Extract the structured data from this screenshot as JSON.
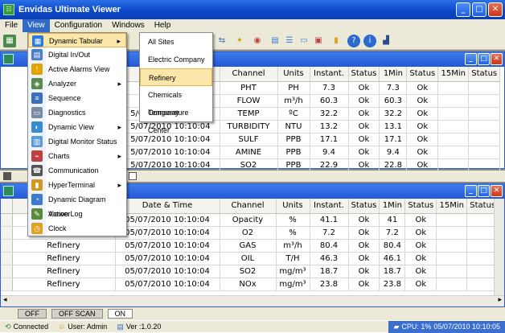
{
  "window": {
    "title": "Envidas Ultimate Viewer"
  },
  "menubar": [
    "File",
    "View",
    "Configuration",
    "Windows",
    "Help"
  ],
  "view_menu": {
    "items": [
      {
        "label": "Dynamic Tabular",
        "icon": "table-icon",
        "color": "#2d7bd6",
        "submenu": true
      },
      {
        "label": "Digital In/Out",
        "icon": "digital-io-icon",
        "color": "#4a7ec8",
        "submenu": false
      },
      {
        "label": "Active Alarms View",
        "icon": "alarm-icon",
        "color": "#e0a400",
        "submenu": false
      },
      {
        "label": "Analyzer",
        "icon": "analyzer-icon",
        "color": "#5a8b4a",
        "submenu": true
      },
      {
        "label": "Sequence",
        "icon": "sequence-icon",
        "color": "#3a6fc0",
        "submenu": false
      },
      {
        "label": "Diagnostics",
        "icon": "diagnostics-icon",
        "color": "#7a8aa0",
        "submenu": false
      },
      {
        "label": "Dynamic View",
        "icon": "dynamic-view-icon",
        "color": "#3a8ad0",
        "submenu": true
      },
      {
        "label": "Digital Monitor Status",
        "icon": "monitor-icon",
        "color": "#5a9ad6",
        "submenu": false
      },
      {
        "label": "Charts",
        "icon": "chart-icon",
        "color": "#c04040",
        "submenu": true
      },
      {
        "label": "Communication",
        "icon": "communication-icon",
        "color": "#555555",
        "submenu": false
      },
      {
        "label": "HyperTerminal",
        "icon": "terminal-icon",
        "color": "#d09a20",
        "submenu": true
      },
      {
        "label": "Dynamic Diagram Viewer",
        "icon": "diagram-icon",
        "color": "#3a7ad0",
        "submenu": false
      },
      {
        "label": "Action Log",
        "icon": "log-icon",
        "color": "#5a8a3a",
        "submenu": false
      },
      {
        "label": "Clock",
        "icon": "clock-icon",
        "color": "#e0a020",
        "submenu": false
      }
    ]
  },
  "submenu": {
    "items": [
      "All Sites",
      "Electric Company",
      "Refinery",
      "Chemicals Company",
      "Temperature Center"
    ],
    "highlight": "Refinery"
  },
  "top_table": {
    "columns": [
      "",
      "Channel",
      "Units",
      "Instant.",
      "Status",
      "1Min",
      "Status",
      "15Min",
      "Status"
    ],
    "rows": [
      [
        "",
        "PHT",
        "PH",
        "7.3",
        "Ok",
        "7.3",
        "Ok",
        "",
        ""
      ],
      [
        "",
        "FLOW",
        "m³/h",
        "60.3",
        "Ok",
        "60.3",
        "Ok",
        "",
        ""
      ],
      [
        "5/07/2010 10:10:04",
        "TEMP",
        "ºC",
        "32.2",
        "Ok",
        "32.2",
        "Ok",
        "",
        ""
      ],
      [
        "5/07/2010 10:10:04",
        "TURBIDITY",
        "NTU",
        "13.2",
        "Ok",
        "13.1",
        "Ok",
        "",
        ""
      ],
      [
        "5/07/2010 10:10:04",
        "SULF",
        "PPB",
        "17.1",
        "Ok",
        "17.1",
        "Ok",
        "",
        ""
      ],
      [
        "5/07/2010 10:10:04",
        "AMINE",
        "PPB",
        "9.4",
        "Ok",
        "9.4",
        "Ok",
        "",
        ""
      ],
      [
        "5/07/2010 10:10:04",
        "SO2",
        "PPB",
        "22.9",
        "Ok",
        "22.8",
        "Ok",
        "",
        ""
      ]
    ]
  },
  "bottom_table": {
    "columns": [
      "",
      "Date & Time",
      "Channel",
      "Units",
      "Instant.",
      "Status",
      "1Min",
      "Status",
      "15Min",
      "Status"
    ],
    "rows": [
      [
        "Refinery",
        "05/07/2010 10:10:04",
        "Opacity",
        "%",
        "41.1",
        "Ok",
        "41",
        "Ok",
        "",
        ""
      ],
      [
        "Refinery",
        "05/07/2010 10:10:04",
        "O2",
        "%",
        "7.2",
        "Ok",
        "7.2",
        "Ok",
        "",
        ""
      ],
      [
        "Refinery",
        "05/07/2010 10:10:04",
        "GAS",
        "m³/h",
        "80.4",
        "Ok",
        "80.4",
        "Ok",
        "",
        ""
      ],
      [
        "Refinery",
        "05/07/2010 10:10:04",
        "OIL",
        "T/H",
        "46.3",
        "Ok",
        "46.1",
        "Ok",
        "",
        ""
      ],
      [
        "Refinery",
        "05/07/2010 10:10:04",
        "SO2",
        "mg/m³",
        "18.7",
        "Ok",
        "18.7",
        "Ok",
        "",
        ""
      ],
      [
        "Refinery",
        "05/07/2010 10:10:04",
        "NOx",
        "mg/m³",
        "23.8",
        "Ok",
        "23.8",
        "Ok",
        "",
        ""
      ]
    ]
  },
  "buttons": {
    "off": "OFF",
    "off_scan": "OFF SCAN",
    "on": "ON"
  },
  "statusbar": {
    "connected": "Connected",
    "user": "User: Admin",
    "version": "Ver :1.0.20",
    "cpu": "CPU: 1%",
    "datetime": "05/07/2010 10:10:05"
  }
}
